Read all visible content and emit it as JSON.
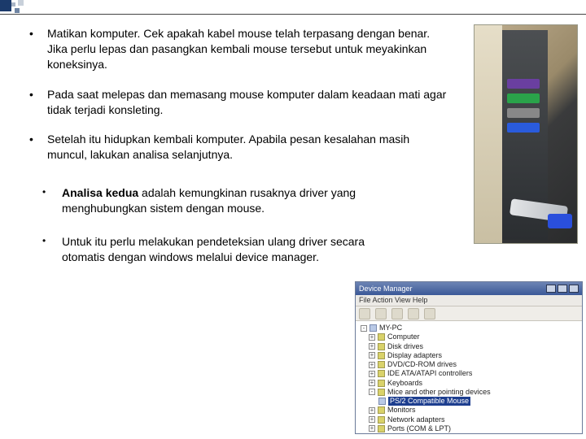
{
  "list1": [
    "Matikan komputer. Cek apakah kabel mouse telah terpasang dengan benar. Jika perlu lepas dan pasangkan kembali mouse tersebut untuk meyakinkan koneksinya.",
    "Pada saat melepas  dan memasang  mouse  komputer  dalam keadaan mati agar  tidak  terjadi konsleting.",
    "Setelah itu hidupkan  kembali komputer. Apabila pesan kesalahan masih muncul, lakukan analisa selanjutnya."
  ],
  "list2_item1_bold": "Analisa kedua",
  "list2_item1_rest": " adalah kemungkinan rusaknya driver yang menghubungkan sistem dengan mouse.",
  "list2_item2": "Untuk  itu perlu melakukan pendeteksian ulang driver secara otomatis dengan windows melalui device manager.",
  "dm": {
    "title": "Device Manager",
    "menu": "File   Action   View   Help",
    "tree": {
      "root": "MY-PC",
      "items": [
        "Computer",
        "Disk drives",
        "Display adapters",
        "DVD/CD-ROM drives",
        "IDE ATA/ATAPI controllers",
        "Keyboards",
        "Mice and other pointing devices"
      ],
      "selected": "PS/2 Compatible Mouse",
      "after": [
        "Monitors",
        "Network adapters",
        "Ports (COM & LPT)"
      ]
    }
  }
}
